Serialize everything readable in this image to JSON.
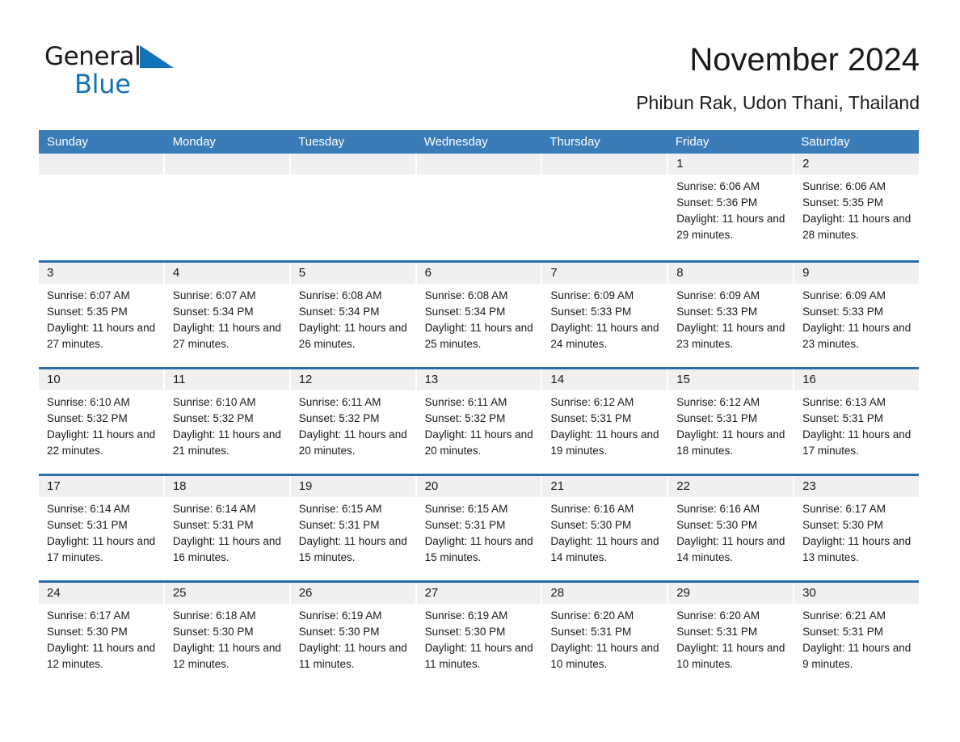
{
  "brand": {
    "name_part1": "General",
    "name_part2": "Blue"
  },
  "header": {
    "month_title": "November 2024",
    "location": "Phibun Rak, Udon Thani, Thailand"
  },
  "colors": {
    "header_blue": "#3a7cb8",
    "row_divider_blue": "#2a6ca8",
    "day_number_band": "#f0f0f0",
    "brand_blue": "#1373b8"
  },
  "weekdays": [
    "Sunday",
    "Monday",
    "Tuesday",
    "Wednesday",
    "Thursday",
    "Friday",
    "Saturday"
  ],
  "labels": {
    "sunrise_prefix": "Sunrise: ",
    "sunset_prefix": "Sunset: ",
    "daylight_prefix": "Daylight: "
  },
  "weeks": [
    [
      {
        "day": "",
        "sunrise": "",
        "sunset": "",
        "daylight": ""
      },
      {
        "day": "",
        "sunrise": "",
        "sunset": "",
        "daylight": ""
      },
      {
        "day": "",
        "sunrise": "",
        "sunset": "",
        "daylight": ""
      },
      {
        "day": "",
        "sunrise": "",
        "sunset": "",
        "daylight": ""
      },
      {
        "day": "",
        "sunrise": "",
        "sunset": "",
        "daylight": ""
      },
      {
        "day": "1",
        "sunrise": "Sunrise: 6:06 AM",
        "sunset": "Sunset: 5:36 PM",
        "daylight": "Daylight: 11 hours and 29 minutes."
      },
      {
        "day": "2",
        "sunrise": "Sunrise: 6:06 AM",
        "sunset": "Sunset: 5:35 PM",
        "daylight": "Daylight: 11 hours and 28 minutes."
      }
    ],
    [
      {
        "day": "3",
        "sunrise": "Sunrise: 6:07 AM",
        "sunset": "Sunset: 5:35 PM",
        "daylight": "Daylight: 11 hours and 27 minutes."
      },
      {
        "day": "4",
        "sunrise": "Sunrise: 6:07 AM",
        "sunset": "Sunset: 5:34 PM",
        "daylight": "Daylight: 11 hours and 27 minutes."
      },
      {
        "day": "5",
        "sunrise": "Sunrise: 6:08 AM",
        "sunset": "Sunset: 5:34 PM",
        "daylight": "Daylight: 11 hours and 26 minutes."
      },
      {
        "day": "6",
        "sunrise": "Sunrise: 6:08 AM",
        "sunset": "Sunset: 5:34 PM",
        "daylight": "Daylight: 11 hours and 25 minutes."
      },
      {
        "day": "7",
        "sunrise": "Sunrise: 6:09 AM",
        "sunset": "Sunset: 5:33 PM",
        "daylight": "Daylight: 11 hours and 24 minutes."
      },
      {
        "day": "8",
        "sunrise": "Sunrise: 6:09 AM",
        "sunset": "Sunset: 5:33 PM",
        "daylight": "Daylight: 11 hours and 23 minutes."
      },
      {
        "day": "9",
        "sunrise": "Sunrise: 6:09 AM",
        "sunset": "Sunset: 5:33 PM",
        "daylight": "Daylight: 11 hours and 23 minutes."
      }
    ],
    [
      {
        "day": "10",
        "sunrise": "Sunrise: 6:10 AM",
        "sunset": "Sunset: 5:32 PM",
        "daylight": "Daylight: 11 hours and 22 minutes."
      },
      {
        "day": "11",
        "sunrise": "Sunrise: 6:10 AM",
        "sunset": "Sunset: 5:32 PM",
        "daylight": "Daylight: 11 hours and 21 minutes."
      },
      {
        "day": "12",
        "sunrise": "Sunrise: 6:11 AM",
        "sunset": "Sunset: 5:32 PM",
        "daylight": "Daylight: 11 hours and 20 minutes."
      },
      {
        "day": "13",
        "sunrise": "Sunrise: 6:11 AM",
        "sunset": "Sunset: 5:32 PM",
        "daylight": "Daylight: 11 hours and 20 minutes."
      },
      {
        "day": "14",
        "sunrise": "Sunrise: 6:12 AM",
        "sunset": "Sunset: 5:31 PM",
        "daylight": "Daylight: 11 hours and 19 minutes."
      },
      {
        "day": "15",
        "sunrise": "Sunrise: 6:12 AM",
        "sunset": "Sunset: 5:31 PM",
        "daylight": "Daylight: 11 hours and 18 minutes."
      },
      {
        "day": "16",
        "sunrise": "Sunrise: 6:13 AM",
        "sunset": "Sunset: 5:31 PM",
        "daylight": "Daylight: 11 hours and 17 minutes."
      }
    ],
    [
      {
        "day": "17",
        "sunrise": "Sunrise: 6:14 AM",
        "sunset": "Sunset: 5:31 PM",
        "daylight": "Daylight: 11 hours and 17 minutes."
      },
      {
        "day": "18",
        "sunrise": "Sunrise: 6:14 AM",
        "sunset": "Sunset: 5:31 PM",
        "daylight": "Daylight: 11 hours and 16 minutes."
      },
      {
        "day": "19",
        "sunrise": "Sunrise: 6:15 AM",
        "sunset": "Sunset: 5:31 PM",
        "daylight": "Daylight: 11 hours and 15 minutes."
      },
      {
        "day": "20",
        "sunrise": "Sunrise: 6:15 AM",
        "sunset": "Sunset: 5:31 PM",
        "daylight": "Daylight: 11 hours and 15 minutes."
      },
      {
        "day": "21",
        "sunrise": "Sunrise: 6:16 AM",
        "sunset": "Sunset: 5:30 PM",
        "daylight": "Daylight: 11 hours and 14 minutes."
      },
      {
        "day": "22",
        "sunrise": "Sunrise: 6:16 AM",
        "sunset": "Sunset: 5:30 PM",
        "daylight": "Daylight: 11 hours and 14 minutes."
      },
      {
        "day": "23",
        "sunrise": "Sunrise: 6:17 AM",
        "sunset": "Sunset: 5:30 PM",
        "daylight": "Daylight: 11 hours and 13 minutes."
      }
    ],
    [
      {
        "day": "24",
        "sunrise": "Sunrise: 6:17 AM",
        "sunset": "Sunset: 5:30 PM",
        "daylight": "Daylight: 11 hours and 12 minutes."
      },
      {
        "day": "25",
        "sunrise": "Sunrise: 6:18 AM",
        "sunset": "Sunset: 5:30 PM",
        "daylight": "Daylight: 11 hours and 12 minutes."
      },
      {
        "day": "26",
        "sunrise": "Sunrise: 6:19 AM",
        "sunset": "Sunset: 5:30 PM",
        "daylight": "Daylight: 11 hours and 11 minutes."
      },
      {
        "day": "27",
        "sunrise": "Sunrise: 6:19 AM",
        "sunset": "Sunset: 5:30 PM",
        "daylight": "Daylight: 11 hours and 11 minutes."
      },
      {
        "day": "28",
        "sunrise": "Sunrise: 6:20 AM",
        "sunset": "Sunset: 5:31 PM",
        "daylight": "Daylight: 11 hours and 10 minutes."
      },
      {
        "day": "29",
        "sunrise": "Sunrise: 6:20 AM",
        "sunset": "Sunset: 5:31 PM",
        "daylight": "Daylight: 11 hours and 10 minutes."
      },
      {
        "day": "30",
        "sunrise": "Sunrise: 6:21 AM",
        "sunset": "Sunset: 5:31 PM",
        "daylight": "Daylight: 11 hours and 9 minutes."
      }
    ]
  ]
}
